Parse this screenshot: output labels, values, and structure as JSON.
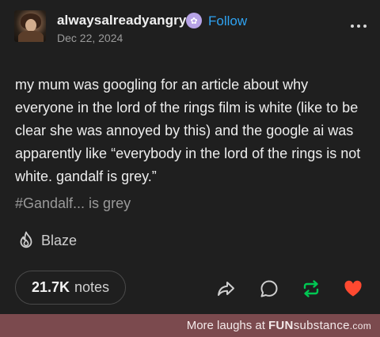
{
  "post": {
    "username": "alwaysalreadyangry",
    "follow_label": "Follow",
    "date": "Dec 22, 2024",
    "body": "my mum was googling for an article about why everyone in the lord of the rings film is white (like to be clear she was annoyed by this) and the google ai was apparently like “everybody in the lord of the rings is not white. gandalf is grey.”",
    "tag": "#Gandalf... is grey",
    "blaze_label": "Blaze"
  },
  "footer": {
    "notes_count": "21.7K",
    "notes_label": "notes"
  },
  "watermark": {
    "prefix": "More laughs at",
    "brand_fun": "FUN",
    "brand_sub": "substance",
    "brand_com": ".com"
  },
  "colors": {
    "background": "#1f1f1f",
    "follow": "#2fa3f2",
    "reblog": "#00c853",
    "like": "#ff4930",
    "watermark_bar": "#7b4a4e"
  }
}
